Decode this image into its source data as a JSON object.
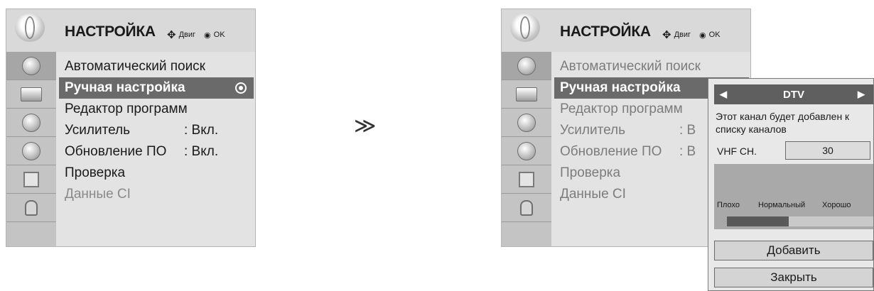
{
  "left_menu": {
    "title": "НАСТРОЙКА",
    "hint_move": "Двиг",
    "hint_ok": "OK",
    "items": [
      {
        "label": "Автоматический поиск",
        "value": ""
      },
      {
        "label": "Ручная настройка",
        "value": ""
      },
      {
        "label": "Редактор программ",
        "value": ""
      },
      {
        "label": "Усилитель",
        "value": ": Вкл."
      },
      {
        "label": "Обновление ПО",
        "value": ": Вкл."
      },
      {
        "label": "Проверка",
        "value": ""
      },
      {
        "label": "Данные CI",
        "value": ""
      }
    ]
  },
  "right_menu": {
    "title": "НАСТРОЙКА",
    "hint_move": "Двиг",
    "hint_ok": "OK",
    "items": [
      {
        "label": "Автоматический поиск",
        "value": ""
      },
      {
        "label": "Ручная настройка",
        "value": ""
      },
      {
        "label": "Редактор программ",
        "value": ""
      },
      {
        "label": "Усилитель",
        "value": ": В"
      },
      {
        "label": "Обновление ПО",
        "value": ": В"
      },
      {
        "label": "Проверка",
        "value": ""
      },
      {
        "label": "Данные CI",
        "value": ""
      }
    ]
  },
  "arrow": "≫",
  "popup": {
    "mode": "DTV",
    "message_line1": "Этот канал будет добавлен к",
    "message_line2": "списку каналов",
    "channel_label": "VHF CH.",
    "channel_value": "30",
    "signal_labels": [
      "Плохо",
      "Нормальный",
      "Хорошо"
    ],
    "signal_level_percent": 42,
    "add_button": "Добавить",
    "close_button": "Закрыть"
  },
  "icons": [
    "antenna-icon",
    "tv-screen-icon",
    "speaker-icon",
    "clock-icon",
    "option-icon",
    "lock-icon"
  ],
  "colors": {
    "menu_bg": "#d9d9d9",
    "selected_bg": "#6a6a6a",
    "popup_bar": "#5f5f5f"
  }
}
